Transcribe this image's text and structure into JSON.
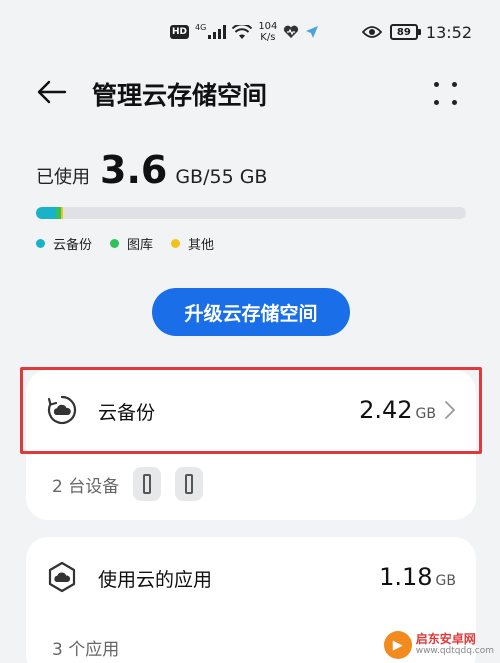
{
  "status_bar": {
    "hd": "HD",
    "network": "4G",
    "speed_value": "104",
    "speed_unit": "K/s",
    "battery": "89",
    "time": "13:52",
    "icons": [
      "hd-icon",
      "signal-icon",
      "wifi-icon",
      "heart-icon",
      "location-icon",
      "eye-icon",
      "battery-icon"
    ]
  },
  "header": {
    "title": "管理云存储空间",
    "back_icon": "back-arrow-icon",
    "more_icon": "more-dots-icon"
  },
  "usage": {
    "used_label": "已使用",
    "used_value": "3.6",
    "total": "GB/55 GB",
    "segments": [
      {
        "name": "云备份",
        "fraction": 0.046,
        "color": "#18b3c8"
      },
      {
        "name": "图库",
        "fraction": 0.012,
        "color": "#2fc25b"
      },
      {
        "name": "其他",
        "fraction": 0.004,
        "color": "#f2c21b"
      }
    ],
    "legend": [
      {
        "label": "云备份",
        "color": "#18b3c8"
      },
      {
        "label": "图库",
        "color": "#2fc25b"
      },
      {
        "label": "其他",
        "color": "#f2c21b"
      }
    ]
  },
  "upgrade_button": "升级云存储空间",
  "cloud_backup": {
    "label": "云备份",
    "value": "2.42",
    "unit": "GB",
    "devices_text": "2 台设备",
    "device_icons": [
      "phone-icon",
      "phone-icon"
    ]
  },
  "cloud_apps": {
    "label": "使用云的应用",
    "value": "1.18",
    "unit": "GB",
    "apps_text": "3 个应用"
  },
  "watermark": {
    "title": "启东安卓网",
    "url": "www.qdtqdq.com"
  }
}
